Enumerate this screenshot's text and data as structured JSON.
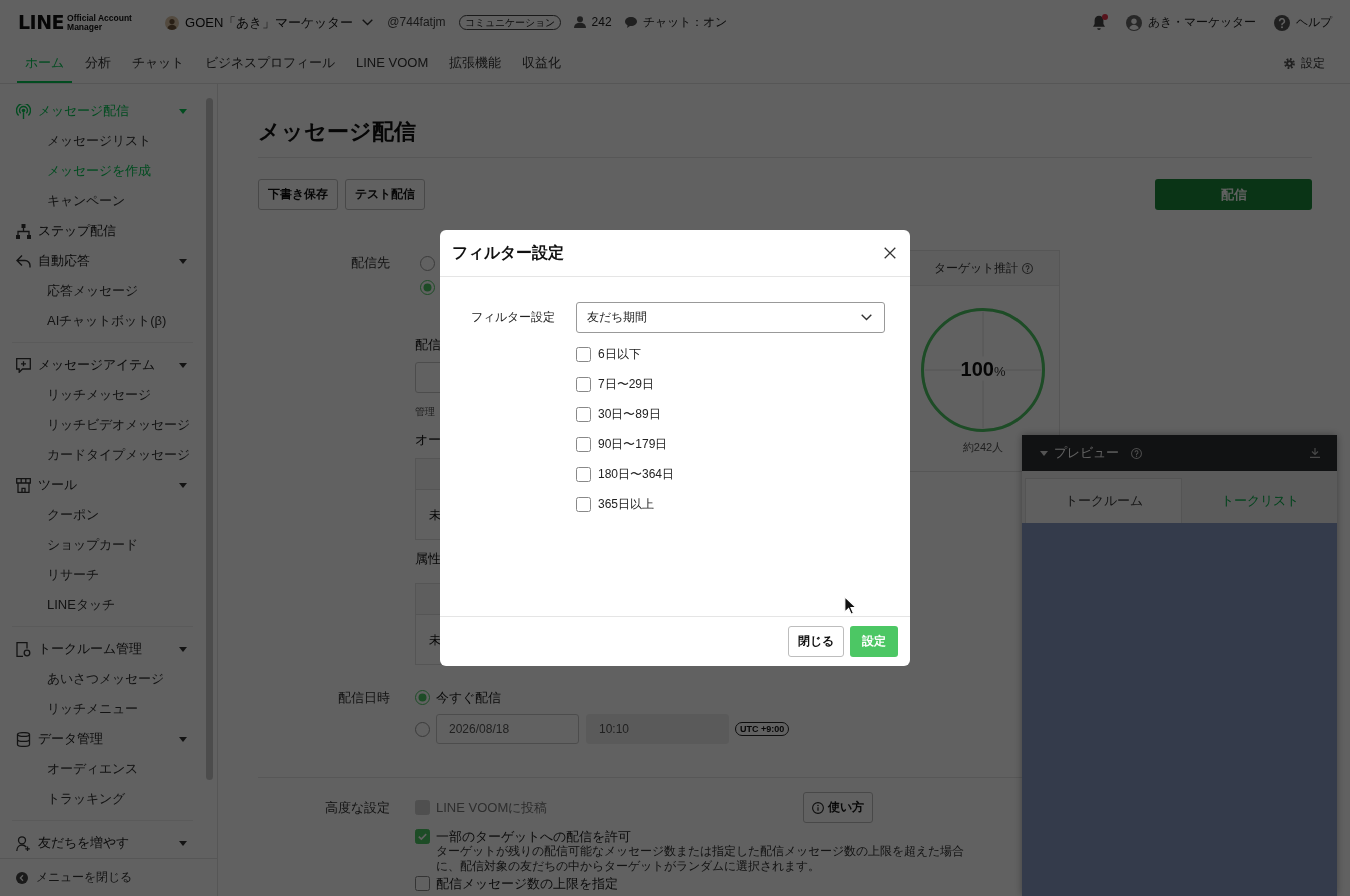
{
  "header": {
    "logo": {
      "wordmark": "LINE",
      "tagline": "Official Account Manager"
    },
    "account": {
      "name": "GOEN「あき」マーケッター",
      "handle": "@744fatjm",
      "plan": "コミュニケーション",
      "friends": "242",
      "chat_status": "チャット：オン"
    },
    "notifications": {
      "unread": true
    },
    "user": "あき・マーケッター",
    "help": "ヘルプ"
  },
  "nav": {
    "tabs": [
      {
        "label": "ホーム",
        "selected": true
      },
      {
        "label": "分析",
        "selected": false
      },
      {
        "label": "チャット",
        "selected": false
      },
      {
        "label": "ビジネスプロフィール",
        "selected": false
      },
      {
        "label": "LINE VOOM",
        "selected": false
      },
      {
        "label": "拡張機能",
        "selected": false
      },
      {
        "label": "収益化",
        "selected": false
      }
    ],
    "settings": "設定"
  },
  "sidebar": {
    "sections": [
      {
        "groups": [
          {
            "label": "メッセージ配信",
            "selected": true,
            "expanded": true,
            "children": [
              {
                "label": "メッセージリスト",
                "selected": false
              },
              {
                "label": "メッセージを作成",
                "selected": true
              },
              {
                "label": "キャンペーン",
                "selected": false
              }
            ]
          },
          {
            "label": "ステップ配信",
            "selected": false
          },
          {
            "label": "自動応答",
            "selected": false,
            "expanded": true,
            "children": [
              {
                "label": "応答メッセージ",
                "selected": false
              },
              {
                "label": "AIチャットボット(β)",
                "selected": false
              }
            ]
          }
        ]
      },
      {
        "groups": [
          {
            "label": "メッセージアイテム",
            "selected": false,
            "expanded": true,
            "children": [
              {
                "label": "リッチメッセージ",
                "selected": false
              },
              {
                "label": "リッチビデオメッセージ",
                "selected": false
              },
              {
                "label": "カードタイプメッセージ",
                "selected": false
              }
            ]
          },
          {
            "label": "ツール",
            "selected": false,
            "expanded": true,
            "children": [
              {
                "label": "クーポン",
                "selected": false
              },
              {
                "label": "ショップカード",
                "selected": false
              },
              {
                "label": "リサーチ",
                "selected": false
              },
              {
                "label": "LINEタッチ",
                "selected": false
              }
            ]
          }
        ]
      },
      {
        "groups": [
          {
            "label": "トークルーム管理",
            "selected": false,
            "expanded": true,
            "children": [
              {
                "label": "あいさつメッセージ",
                "selected": false
              },
              {
                "label": "リッチメニュー",
                "selected": false
              }
            ]
          },
          {
            "label": "データ管理",
            "selected": false,
            "expanded": true,
            "children": [
              {
                "label": "オーディエンス",
                "selected": false
              },
              {
                "label": "トラッキング",
                "selected": false
              }
            ]
          }
        ]
      },
      {
        "groups": [
          {
            "label": "友だちを増やす",
            "selected": false,
            "expanded": true
          }
        ]
      }
    ],
    "collapse": "メニューを閉じる"
  },
  "page": {
    "title": "メッセージ配信",
    "actions": [
      {
        "label": "下書き保存",
        "kind": "secondary"
      },
      {
        "label": "テスト配信",
        "kind": "secondary"
      },
      {
        "label": "配信",
        "kind": "primary"
      }
    ]
  },
  "recipients": {
    "label": "配信先",
    "options": [
      {
        "selected": false
      },
      {
        "selected": true
      }
    ],
    "section_label": "配信",
    "note": "管理",
    "audience": {
      "heading": "オー",
      "cell": "未"
    },
    "attributes": {
      "heading": "属性",
      "cell": "未"
    }
  },
  "estimate": {
    "title": "ターゲット推計",
    "level": 1,
    "value": "100",
    "unit": "%",
    "count": "約242人"
  },
  "schedule": {
    "label": "配信日時",
    "options": [
      {
        "kind": "now",
        "label": "今すぐ配信",
        "selected": true
      },
      {
        "kind": "datetime",
        "selected": false,
        "date": {
          "placeholder": "2026/08/18"
        },
        "time": {
          "placeholder": "10:10",
          "disabled": true
        },
        "timezone": "UTC +9:00"
      }
    ]
  },
  "advanced": {
    "label": "高度な設定",
    "help_button": "使い方",
    "options": [
      {
        "label": "LINE VOOMに投稿",
        "checked": false,
        "disabled": true
      },
      {
        "label": "一部のターゲットへの配信を許可",
        "checked": true,
        "disabled": false,
        "description": "ターゲットが残りの配信可能なメッセージ数または指定した配信メッセージ数の上限を超えた場合に、配信対象の友だちの中からターゲットがランダムに選択されます。"
      },
      {
        "label": "配信メッセージ数の上限を指定",
        "checked": false,
        "disabled": false
      }
    ]
  },
  "preview": {
    "title": "プレビュー",
    "expanded": true,
    "tabs": [
      {
        "label": "トークルーム",
        "selected": true
      },
      {
        "label": "トークリスト",
        "selected": false
      }
    ]
  },
  "modal": {
    "title": "フィルター設定",
    "field_label": "フィルター設定",
    "select": {
      "value": "友だち期間"
    },
    "options": [
      {
        "label": "6日以下",
        "checked": false
      },
      {
        "label": "7日〜29日",
        "checked": false
      },
      {
        "label": "30日〜89日",
        "checked": false
      },
      {
        "label": "90日〜179日",
        "checked": false
      },
      {
        "label": "180日〜364日",
        "checked": false
      },
      {
        "label": "365日以上",
        "checked": false
      }
    ],
    "buttons": [
      {
        "label": "閉じる",
        "kind": "secondary"
      },
      {
        "label": "設定",
        "kind": "primary"
      }
    ]
  }
}
